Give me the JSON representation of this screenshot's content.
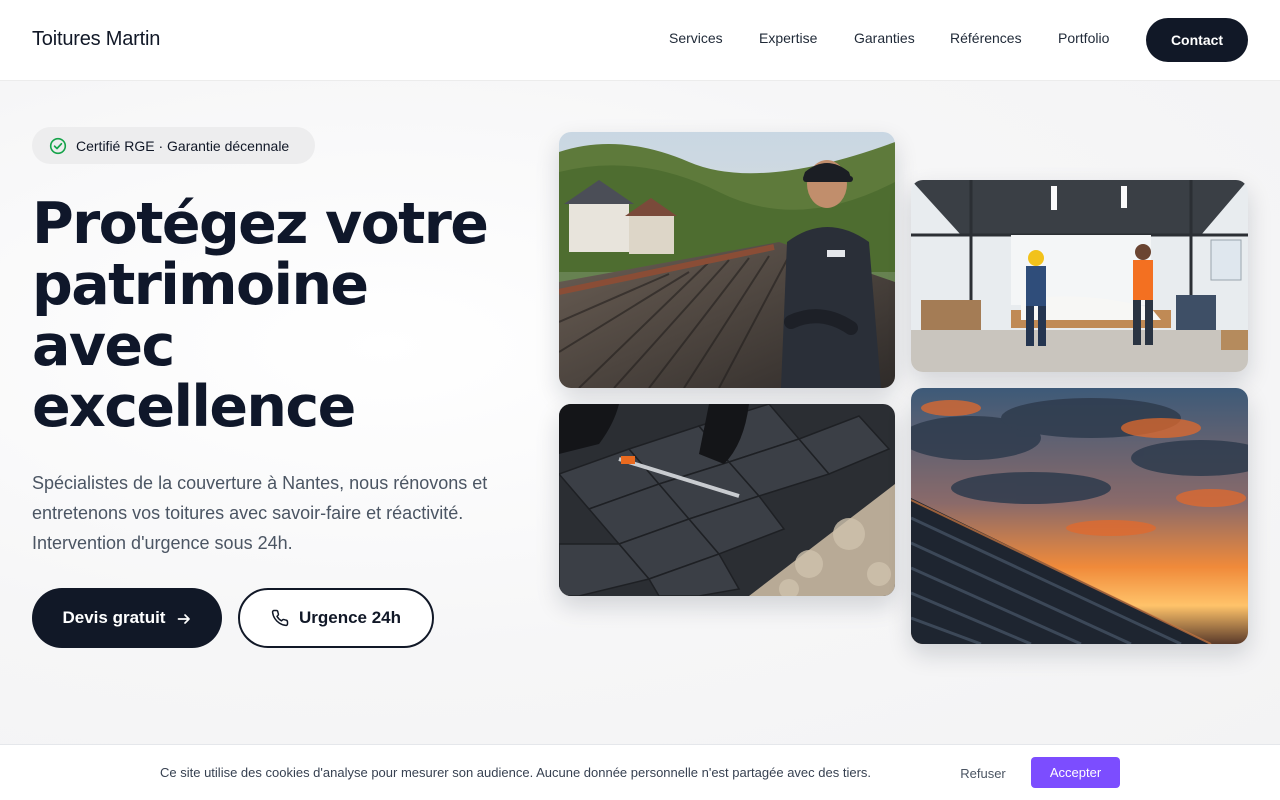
{
  "header": {
    "brand": "Toitures Martin",
    "nav": [
      {
        "label": "Services"
      },
      {
        "label": "Expertise"
      },
      {
        "label": "Garanties"
      },
      {
        "label": "Références"
      },
      {
        "label": "Portfolio"
      }
    ],
    "contact_label": "Contact"
  },
  "hero": {
    "badge": {
      "icon": "check-circle-icon",
      "text": "Certifié RGE · Garantie décennale"
    },
    "headline_lines": [
      "Protégez votre",
      "patrimoine",
      "avec",
      "excellence"
    ],
    "subtitle": "Spécialistes de la couverture à Nantes, nous rénovons et entretenons vos toitures avec savoir-faire et réactivité. Intervention d'urgence sous 24h.",
    "primary_button": {
      "label": "Devis gratuit",
      "icon": "arrow-right-icon"
    },
    "secondary_button": {
      "label": "Urgence 24h",
      "icon": "phone-icon"
    }
  },
  "gallery": [
    {
      "name": "roofer-portrait-photo"
    },
    {
      "name": "workshop-planning-photo"
    },
    {
      "name": "slate-installation-photo"
    },
    {
      "name": "metal-roof-sunset-photo"
    }
  ],
  "cookie_banner": {
    "text": "Ce site utilise des cookies d'analyse pour mesurer son audience. Aucune donnée personnelle n'est partagée avec des tiers.",
    "refuse_label": "Refuser",
    "accept_label": "Accepter"
  },
  "colors": {
    "primary": "#111827",
    "accent": "#7c4dff",
    "badge_check": "#16a34a"
  }
}
